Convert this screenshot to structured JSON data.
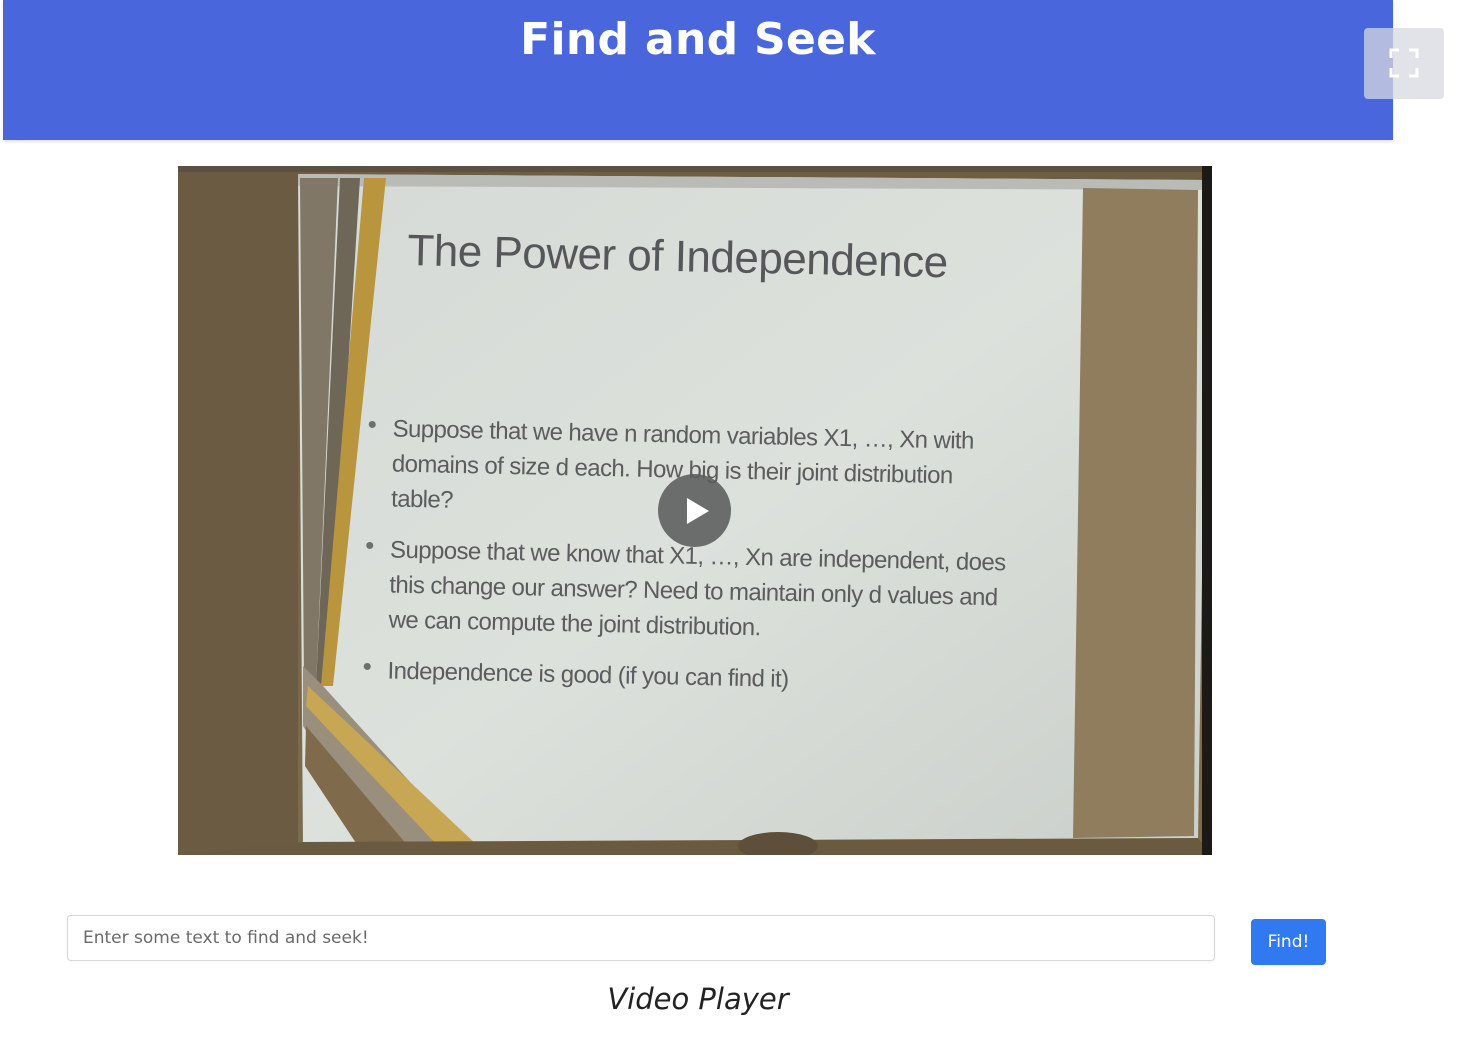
{
  "header": {
    "title": "Find and Seek",
    "background_color": "#4966dc"
  },
  "fullscreen_button": {
    "icon": "fullscreen-icon"
  },
  "video": {
    "state": "paused",
    "play_icon": "play-icon",
    "slide": {
      "title": "The Power of Independence",
      "bullets": [
        "Suppose that we have n random variables X1, …, Xn with domains of size d each. How big is their joint distribution table?",
        "Suppose that we know that X1, …, Xn are independent, does this change our answer? Need to maintain only d values and we can compute the joint distribution.",
        "Independence is good (if you can find it)"
      ]
    }
  },
  "search": {
    "placeholder": "Enter some text to find and seek!",
    "value": "",
    "button_label": "Find!",
    "button_color": "#3079f0"
  },
  "caption": "Video Player"
}
